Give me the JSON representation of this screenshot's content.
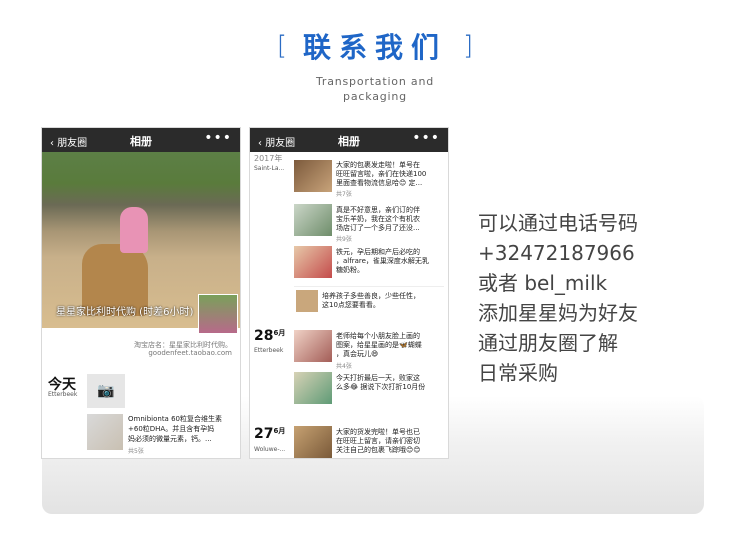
{
  "header": {
    "title": "联系我们",
    "bracket_left": "[",
    "bracket_right": "]",
    "subtitle_line1": "Transportation and",
    "subtitle_line2": "packaging"
  },
  "left_phone": {
    "back_label": "朋友圈",
    "title": "相册",
    "more": "•••",
    "cover_caption": "星星家比利时代购 (时差6小时)",
    "shop_line1": "淘宝店名：星星家比利时代购。",
    "shop_line2": "goodenfeet.taobao.com",
    "today": "今天",
    "today_loc": "Etterbeek",
    "post_text_l1": "Omnibionta 60粒复合维生素",
    "post_text_l2": "+60粒DHA。并且含有孕妈",
    "post_text_l3": "妈必须的微量元素，钙。...",
    "post_meta": "共5张"
  },
  "right_phone": {
    "back_label": "朋友圈",
    "title": "相册",
    "more": "•••",
    "year": "2017年",
    "loc1": "Saint-La...",
    "post1": [
      "大家的包裹发走啦！单号在",
      "旺旺留言啦，亲们在快递100",
      "里面查看物流信息哈😊 定..."
    ],
    "post1_meta": "共7张",
    "post2": [
      "真是不好意思，亲们订的伴",
      "宝乐羊奶，我在这个有机农",
      "场店订了一个多月了还没..."
    ],
    "post2_meta": "共9张",
    "post3": [
      "铁元，孕后期和产后必吃的",
      "，alfrare，雀巢深度水解无乳",
      "糖奶粉。"
    ],
    "post4": [
      "培养孩子多些善良，少些任性，",
      "这10点您要看看。"
    ],
    "day1": "28",
    "day1_month": "6月",
    "loc2": "Etterbeek",
    "post5": [
      "老师给每个小朋友脸上画的",
      "图案，给星星画的是🦋蝴蝶",
      "，真会玩儿😄"
    ],
    "post5_meta": "共4张",
    "post6": [
      "今天打折最后一天，败家这",
      "么多😂 据说下次打折10月份"
    ],
    "day2": "27",
    "day2_month": "6月",
    "loc3": "Woluwe-...",
    "post7": [
      "大家的货发完啦！单号也已",
      "在旺旺上留言，请亲们密切",
      "关注自己的包裹飞踪哦😊😊"
    ]
  },
  "contact": {
    "line1": "可以通过电话号码",
    "line2": "+32472187966",
    "line3": "或者 bel_milk",
    "line4": "添加星星妈为好友",
    "line5": "通过朋友圈了解",
    "line6": "日常采购"
  },
  "colors": {
    "accent": "#1f66c7",
    "topbar": "#2b2b2b"
  }
}
